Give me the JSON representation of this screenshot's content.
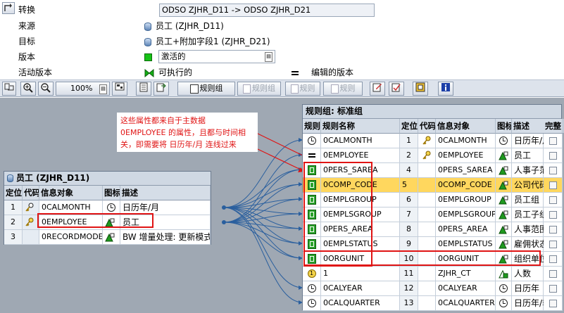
{
  "header": {
    "transform_label": "转换",
    "transform_value": "ODSO ZJHR_D11 -> ODSO ZJHR_D21",
    "source_label": "来源",
    "source_value": "员工 (ZJHR_D11)",
    "target_label": "目标",
    "target_value": "员工+附加字段1 (ZJHR_D21)",
    "version_label": "版本",
    "version_value": "激活的",
    "active_version_label": "活动版本",
    "active_version_value": "可执行的",
    "edit_version_value": "编辑的版本"
  },
  "toolbar": {
    "zoom_value": "100%",
    "rule_group_label": "规则组",
    "rule_group_disabled_label": "规则组",
    "rule_label": "规则",
    "rule_label_2": "规则"
  },
  "annotation": {
    "line1": "这些属性都来自于主数据",
    "line2": "0EMPLOYEE 的属性，且都与时间相",
    "line3": "关，即需要将 日历年/月 连线过来"
  },
  "source_grid": {
    "title": "员工 (ZJHR_D11)",
    "headers": [
      "定位",
      "代码",
      "信息对象",
      "图标",
      "描述"
    ],
    "rows": [
      {
        "pos": "1",
        "icon": "key-clock-icon",
        "object": "0CALMONTH",
        "type_icon": "clock-icon",
        "desc": "日历年/月"
      },
      {
        "pos": "2",
        "icon": "key-icon",
        "object": "0EMPLOYEE",
        "type_icon": "characteristic-icon",
        "desc": "员工"
      },
      {
        "pos": "3",
        "icon": "",
        "object": "0RECORDMODE",
        "type_icon": "characteristic-icon",
        "desc": "BW 增量处理: 更新模式"
      }
    ]
  },
  "rule_grid": {
    "title": "规则组: 标准组",
    "headers": [
      "规则",
      "规则名称",
      "定位",
      "代码",
      "信息对象",
      "图标",
      "描述",
      "完整"
    ],
    "rows": [
      {
        "rule_icon": "clock-icon",
        "name": "0CALMONTH",
        "pos": "1",
        "key": "key-icon",
        "object": "0CALMONTH",
        "type_icon": "clock-icon",
        "desc": "日历年/月"
      },
      {
        "rule_icon": "equal-icon",
        "name": "0EMPLOYEE",
        "pos": "2",
        "key": "key-icon",
        "object": "0EMPLOYEE",
        "type_icon": "characteristic-icon",
        "desc": "员工"
      },
      {
        "rule_icon": "routine-icon",
        "name": "0PERS_SAREA",
        "pos": "4",
        "key": "",
        "object": "0PERS_SAREA",
        "type_icon": "characteristic-icon",
        "desc": "人事子范围"
      },
      {
        "rule_icon": "routine-icon",
        "name": "0COMP_CODE",
        "pos": "5",
        "key": "",
        "object": "0COMP_CODE",
        "type_icon": "characteristic-icon",
        "desc": "公司代码"
      },
      {
        "rule_icon": "routine-icon",
        "name": "0EMPLGROUP",
        "pos": "6",
        "key": "",
        "object": "0EMPLGROUP",
        "type_icon": "characteristic-icon",
        "desc": "员工组"
      },
      {
        "rule_icon": "routine-icon",
        "name": "0EMPLSGROUP",
        "pos": "7",
        "key": "",
        "object": "0EMPLSGROUP",
        "type_icon": "characteristic-icon",
        "desc": "员工子组"
      },
      {
        "rule_icon": "routine-icon",
        "name": "0PERS_AREA",
        "pos": "8",
        "key": "",
        "object": "0PERS_AREA",
        "type_icon": "characteristic-icon",
        "desc": "人事范围"
      },
      {
        "rule_icon": "routine-icon",
        "name": "0EMPLSTATUS",
        "pos": "9",
        "key": "",
        "object": "0EMPLSTATUS",
        "type_icon": "characteristic-icon",
        "desc": "雇佣状态"
      },
      {
        "rule_icon": "routine-icon",
        "name": "0ORGUNIT",
        "pos": "10",
        "key": "",
        "object": "0ORGUNIT",
        "type_icon": "characteristic-icon",
        "desc": "组织单位"
      },
      {
        "rule_icon": "constant-icon",
        "name": "1",
        "pos": "11",
        "key": "",
        "object": "ZJHR_CT",
        "type_icon": "keyfigure-icon",
        "desc": "人数"
      },
      {
        "rule_icon": "clock-icon",
        "name": "0CALYEAR",
        "pos": "12",
        "key": "",
        "object": "0CALYEAR",
        "type_icon": "clock-icon",
        "desc": "日历年"
      },
      {
        "rule_icon": "clock-icon",
        "name": "0CALQUARTER",
        "pos": "13",
        "key": "",
        "object": "0CALQUARTER",
        "type_icon": "clock-icon",
        "desc": "日历年/季度"
      }
    ]
  },
  "colors": {
    "highlight": "#ffd75e",
    "annotation": "#e01414",
    "canvas": "#9fa8b3",
    "connector": "#2a5f9e"
  }
}
